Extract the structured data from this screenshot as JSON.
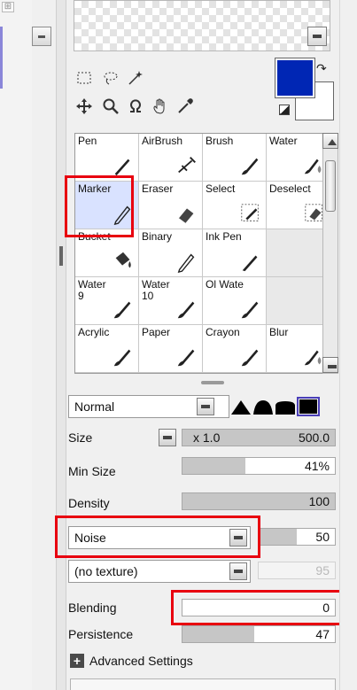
{
  "brushes": [
    {
      "label": "Pen",
      "icon": "pen-icon"
    },
    {
      "label": "AirBrush",
      "icon": "airbrush-icon"
    },
    {
      "label": "Brush",
      "icon": "brush-icon"
    },
    {
      "label": "Water",
      "icon": "water-brush-icon"
    },
    {
      "label": "Marker",
      "icon": "marker-icon",
      "selected": true
    },
    {
      "label": "Eraser",
      "icon": "eraser-icon"
    },
    {
      "label": "Select",
      "icon": "select-brush-icon"
    },
    {
      "label": "Deselect",
      "icon": "deselect-brush-icon"
    },
    {
      "label": "Bucket",
      "icon": "bucket-icon"
    },
    {
      "label": "Binary",
      "icon": "binary-pen-icon"
    },
    {
      "label": "Ink Pen",
      "icon": "ink-pen-icon"
    },
    {
      "label": "",
      "icon": ""
    },
    {
      "label": "Water\n9",
      "icon": "brush-icon"
    },
    {
      "label": "Water\n10",
      "icon": "brush-icon"
    },
    {
      "label": "Ol Wate",
      "icon": "brush-icon"
    },
    {
      "label": "",
      "icon": ""
    },
    {
      "label": "Acrylic",
      "icon": "brush-icon"
    },
    {
      "label": "Paper",
      "icon": "brush-icon"
    },
    {
      "label": "Crayon",
      "icon": "brush-icon"
    },
    {
      "label": "Blur",
      "icon": "water-brush-icon"
    }
  ],
  "colors": {
    "primary": "#0026b4",
    "secondary": "#ffffff",
    "highlight": "#e8000f"
  },
  "blend_mode": "Normal",
  "size": {
    "label": "Size",
    "multiplier": "x 1.0",
    "value": "500.0"
  },
  "min_size": {
    "label": "Min Size",
    "value": "41%",
    "fraction": 0.41
  },
  "density": {
    "label": "Density",
    "value": "100",
    "fraction": 1.0
  },
  "noise": {
    "select": "Noise",
    "value": "50",
    "fraction": 0.5
  },
  "texture": {
    "select": "(no texture)",
    "value": "95"
  },
  "blending": {
    "label": "Blending",
    "value": "0",
    "fraction": 0.0
  },
  "persistence": {
    "label": "Persistence",
    "value": "47",
    "fraction": 0.47
  },
  "advanced_label": "Advanced Settings"
}
